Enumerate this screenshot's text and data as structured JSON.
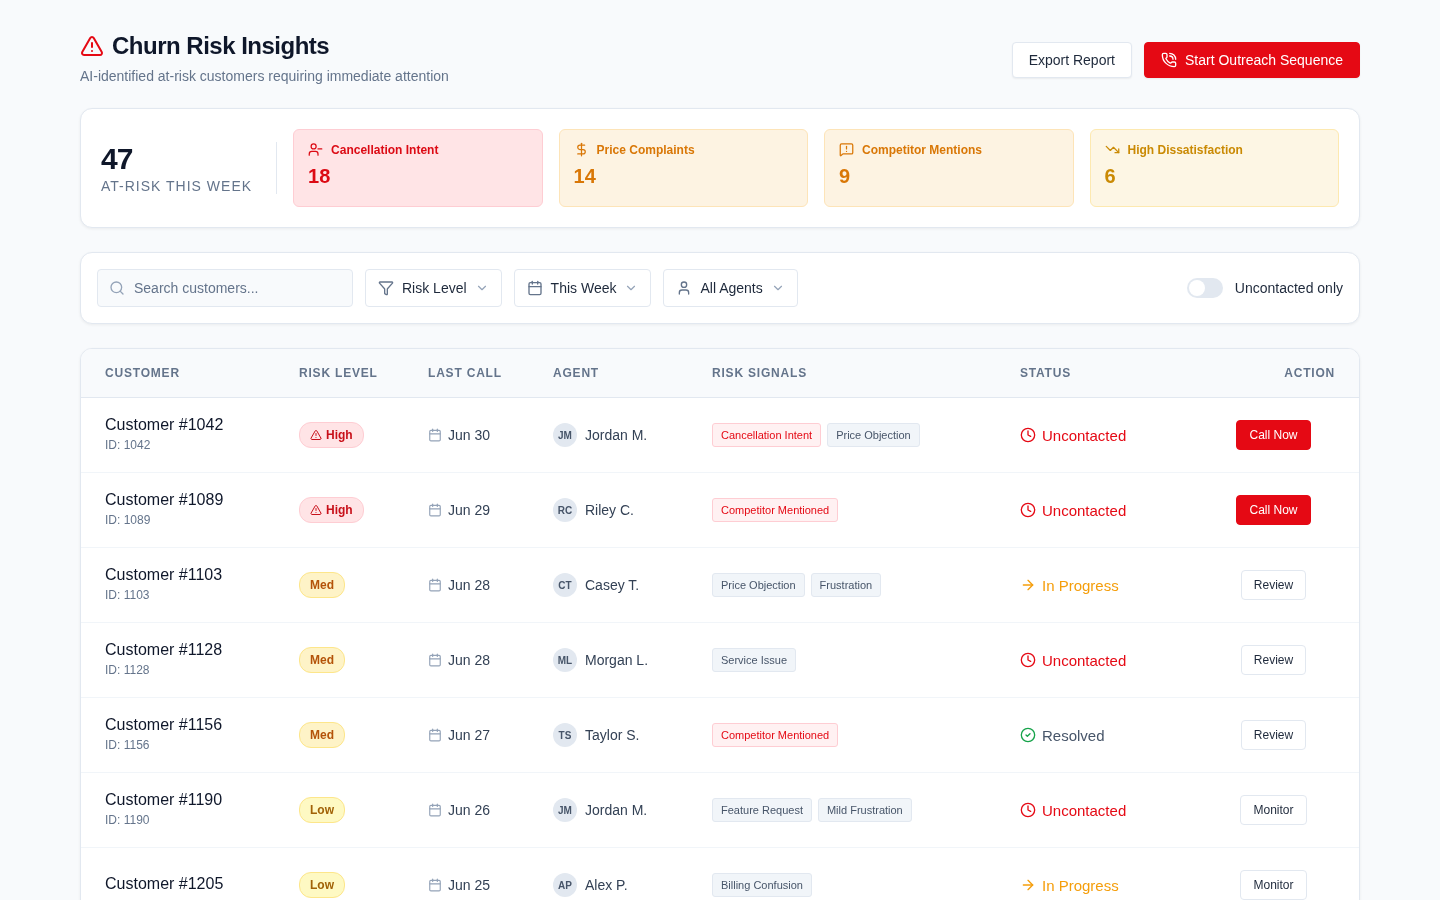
{
  "header": {
    "title": "Churn Risk Insights",
    "subtitle": "AI-identified at-risk customers requiring immediate attention",
    "buttons": [
      {
        "label": "Export Report",
        "kind": "outline"
      },
      {
        "label": "Start Outreach Sequence",
        "kind": "primary"
      }
    ]
  },
  "summary": {
    "total": "47",
    "total_label": "AT-RISK THIS WEEK",
    "cards": [
      {
        "kind": "cancellation",
        "label": "Cancellation Intent",
        "value": "18"
      },
      {
        "kind": "price",
        "label": "Price Complaints",
        "value": "14"
      },
      {
        "kind": "competitor",
        "label": "Competitor Mentions",
        "value": "9"
      },
      {
        "kind": "dissatisfaction",
        "label": "High Dissatisfaction",
        "value": "6"
      }
    ]
  },
  "filters": {
    "search": {
      "placeholder": "Search customers..."
    },
    "dropdowns": [
      {
        "kind": "filter",
        "label": "Risk Level"
      },
      {
        "kind": "calendar",
        "label": "This Week"
      },
      {
        "kind": "user",
        "label": "All Agents"
      }
    ],
    "toggle": {
      "label": "Uncontacted only",
      "on": false
    }
  },
  "table": {
    "columns": [
      "CUSTOMER",
      "RISK LEVEL",
      "LAST CALL",
      "AGENT",
      "RISK SIGNALS",
      "STATUS",
      "ACTION"
    ],
    "rows": [
      {
        "customer": "Customer #1042",
        "id": "ID: 1042",
        "risk": {
          "kind": "high",
          "label": "High"
        },
        "last_call": "Jun 30",
        "agent_initials": "JM",
        "agent": "Jordan M.",
        "signals": [
          {
            "kind": "alert",
            "label": "Cancellation Intent"
          },
          {
            "kind": "neutral",
            "label": "Price Objection"
          }
        ],
        "status": {
          "kind": "uncontacted",
          "label": "Uncontacted"
        },
        "action": {
          "kind": "primary",
          "label": "Call Now"
        }
      },
      {
        "customer": "Customer #1089",
        "id": "ID: 1089",
        "risk": {
          "kind": "high",
          "label": "High"
        },
        "last_call": "Jun 29",
        "agent_initials": "RC",
        "agent": "Riley C.",
        "signals": [
          {
            "kind": "alert",
            "label": "Competitor Mentioned"
          }
        ],
        "status": {
          "kind": "uncontacted",
          "label": "Uncontacted"
        },
        "action": {
          "kind": "primary",
          "label": "Call Now"
        }
      },
      {
        "customer": "Customer #1103",
        "id": "ID: 1103",
        "risk": {
          "kind": "med",
          "label": "Med"
        },
        "last_call": "Jun 28",
        "agent_initials": "CT",
        "agent": "Casey T.",
        "signals": [
          {
            "kind": "neutral",
            "label": "Price Objection"
          },
          {
            "kind": "neutral",
            "label": "Frustration"
          }
        ],
        "status": {
          "kind": "progress",
          "label": "In Progress"
        },
        "action": {
          "kind": "outline",
          "label": "Review"
        }
      },
      {
        "customer": "Customer #1128",
        "id": "ID: 1128",
        "risk": {
          "kind": "med",
          "label": "Med"
        },
        "last_call": "Jun 28",
        "agent_initials": "ML",
        "agent": "Morgan L.",
        "signals": [
          {
            "kind": "neutral",
            "label": "Service Issue"
          }
        ],
        "status": {
          "kind": "uncontacted",
          "label": "Uncontacted"
        },
        "action": {
          "kind": "outline",
          "label": "Review"
        }
      },
      {
        "customer": "Customer #1156",
        "id": "ID: 1156",
        "risk": {
          "kind": "med",
          "label": "Med"
        },
        "last_call": "Jun 27",
        "agent_initials": "TS",
        "agent": "Taylor S.",
        "signals": [
          {
            "kind": "alert",
            "label": "Competitor Mentioned"
          }
        ],
        "status": {
          "kind": "resolved",
          "label": "Resolved"
        },
        "action": {
          "kind": "outline",
          "label": "Review"
        }
      },
      {
        "customer": "Customer #1190",
        "id": "ID: 1190",
        "risk": {
          "kind": "low",
          "label": "Low"
        },
        "last_call": "Jun 26",
        "agent_initials": "JM",
        "agent": "Jordan M.",
        "signals": [
          {
            "kind": "neutral",
            "label": "Feature Request"
          },
          {
            "kind": "neutral",
            "label": "Mild Frustration"
          }
        ],
        "status": {
          "kind": "uncontacted",
          "label": "Uncontacted"
        },
        "action": {
          "kind": "outline",
          "label": "Monitor"
        }
      },
      {
        "customer": "Customer #1205",
        "risk": {
          "kind": "low",
          "label": "Low"
        },
        "last_call": "Jun 25",
        "agent_initials": "AP",
        "agent": "Alex P.",
        "signals": [
          {
            "kind": "neutral",
            "label": "Billing Confusion"
          }
        ],
        "status": {
          "kind": "progress",
          "label": "In Progress"
        },
        "action": {
          "kind": "outline",
          "label": "Monitor"
        }
      }
    ]
  }
}
